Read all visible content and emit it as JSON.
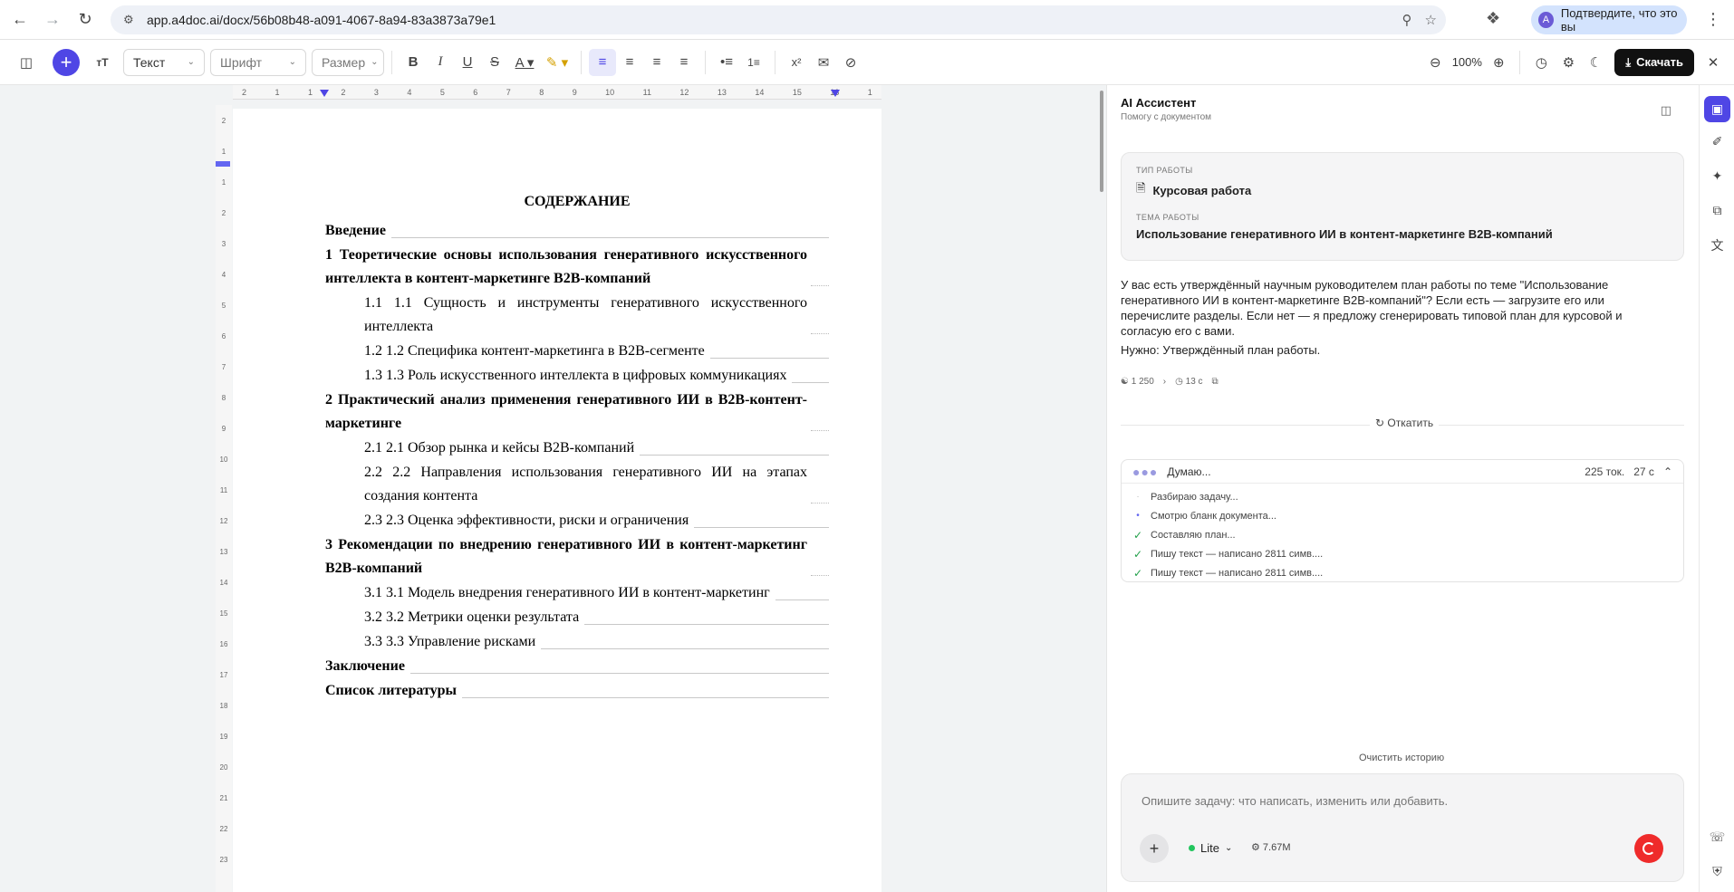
{
  "browser": {
    "url": "app.a4doc.ai/docx/56b08b48-a091-4067-8a94-83a3873a79e1",
    "profile_label": "Подтвердите, что это вы",
    "profile_initial": "А"
  },
  "toolbar": {
    "style_select": "Текст",
    "font_select": "Шрифт",
    "size_select": "Размер",
    "zoom": "100%",
    "download_label": "Скачать"
  },
  "document": {
    "title": "СОДЕРЖАНИЕ",
    "entries": [
      {
        "text": "Введение",
        "level": 1,
        "wrap": false
      },
      {
        "text": "1 Теоретические основы использования генеративного искусственного интеллекта в контент-маркетинге B2B-компаний",
        "level": 1,
        "wrap": true
      },
      {
        "text": "1.1 1.1 Сущность и инструменты генеративного искусственного интеллекта",
        "level": 2,
        "wrap": true
      },
      {
        "text": "1.2 1.2 Специфика контент-маркетинга в B2B-сегменте",
        "level": 2,
        "wrap": false
      },
      {
        "text": "1.3 1.3 Роль искусственного интеллекта в цифровых коммуникациях",
        "level": 2,
        "wrap": false
      },
      {
        "text": "2 Практический анализ применения генеративного ИИ в B2B-контент-маркетинге",
        "level": 1,
        "wrap": true
      },
      {
        "text": "2.1 2.1 Обзор рынка и кейсы B2B-компаний",
        "level": 2,
        "wrap": false
      },
      {
        "text": "2.2 2.2 Направления использования генеративного ИИ на этапах создания контента",
        "level": 2,
        "wrap": true
      },
      {
        "text": "2.3 2.3 Оценка эффективности, риски и ограничения",
        "level": 2,
        "wrap": false
      },
      {
        "text": "3 Рекомендации по внедрению генеративного ИИ в контент-маркетинг B2B-компаний",
        "level": 1,
        "wrap": true
      },
      {
        "text": "3.1 3.1 Модель внедрения генеративного ИИ в контент-маркетинг",
        "level": 2,
        "wrap": false
      },
      {
        "text": "3.2 3.2 Метрики оценки результата",
        "level": 2,
        "wrap": false
      },
      {
        "text": "3.3 3.3 Управление рисками",
        "level": 2,
        "wrap": false
      },
      {
        "text": "Заключение",
        "level": 1,
        "wrap": false
      },
      {
        "text": "Список литературы",
        "level": 1,
        "wrap": false
      }
    ],
    "ruler_numbers": [
      "2",
      "1",
      "1",
      "2",
      "3",
      "4",
      "5",
      "6",
      "7",
      "8",
      "9",
      "10",
      "11",
      "12",
      "13",
      "14",
      "15",
      "16",
      "1"
    ],
    "vruler_numbers": [
      "2",
      "1",
      "1",
      "2",
      "3",
      "4",
      "5",
      "6",
      "7",
      "8",
      "9",
      "10",
      "11",
      "12",
      "13",
      "14",
      "15",
      "16",
      "17",
      "18",
      "19",
      "20",
      "21",
      "22",
      "23"
    ]
  },
  "assistant": {
    "title": "AI Ассистент",
    "subtitle": "Помогу с документом",
    "work_type_label": "ТИП РАБОТЫ",
    "work_type": "Курсовая работа",
    "topic_label": "ТЕМА РАБОТЫ",
    "topic": "Использование генеративного ИИ в контент-маркетинге B2B-компаний",
    "message": "У вас есть утверждённый научным руководителем план работы по теме \"Использование генеративного ИИ в контент-маркетинге B2B-компаний\"? Если есть — загрузите его или перечислите разделы. Если нет — я предложу сгенерировать типовой план для курсовой и согласую его с вами.",
    "need": "Нужно: Утверждённый план работы.",
    "meta_tokens": "1 250",
    "meta_time": "13 с",
    "rollback": "Откатить",
    "thinking": {
      "label": "Думаю...",
      "tokens": "225 ток.",
      "time": "27 с",
      "steps": [
        {
          "text": "Разбираю задачу...",
          "state": "wait"
        },
        {
          "text": "Смотрю бланк документа...",
          "state": "run"
        },
        {
          "text": "Составляю план...",
          "state": "ok"
        },
        {
          "text": "Пишу текст — написано 2811 симв....",
          "state": "ok"
        },
        {
          "text": "Пишу текст — написано 2811 симв....",
          "state": "ok"
        }
      ]
    },
    "clear_history": "Очистить историю",
    "input_placeholder": "Опишите задачу: что написать, изменить или добавить.",
    "model": "Lite",
    "token_balance": "7.67M"
  }
}
